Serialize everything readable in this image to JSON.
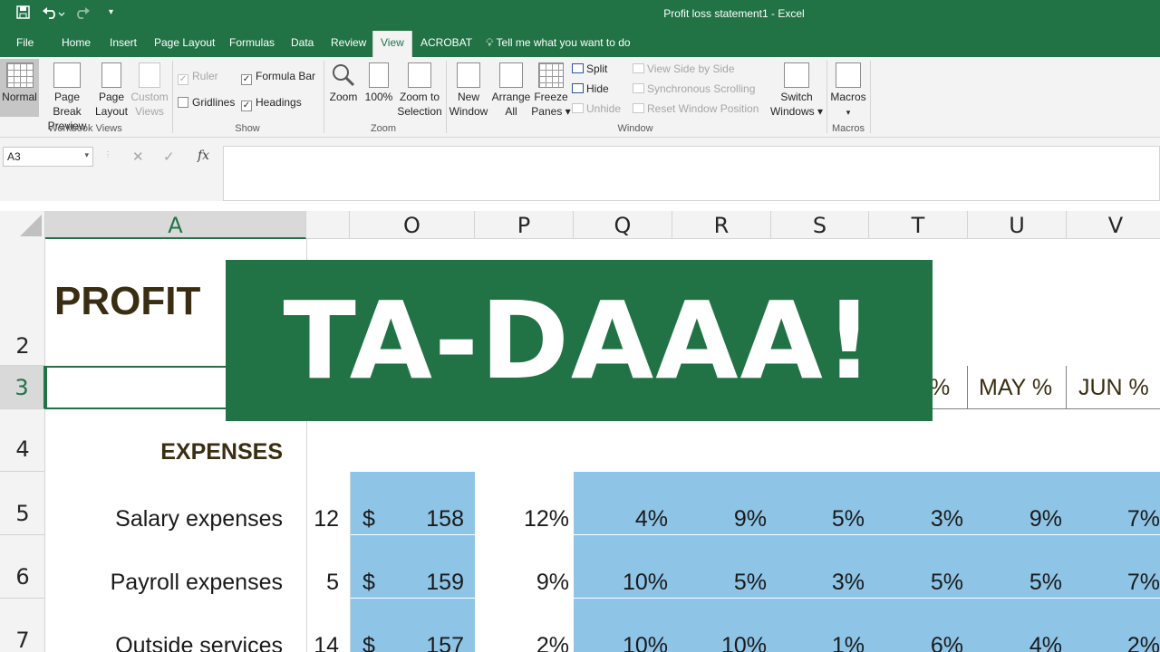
{
  "titlebar": {
    "title": "Profit loss statement1  -  Excel",
    "save_icon": "save-icon",
    "undo_icon": "undo-icon",
    "redo_icon": "redo-icon"
  },
  "tabs": {
    "file": "File",
    "home": "Home",
    "insert": "Insert",
    "page_layout": "Page Layout",
    "formulas": "Formulas",
    "data": "Data",
    "review": "Review",
    "view": "View",
    "acrobat": "ACROBAT",
    "tell_me": "Tell me what you want to do"
  },
  "ribbon": {
    "workbook_views": {
      "label": "Workbook Views",
      "normal": "Normal",
      "page_break_1": "Page Break",
      "page_break_2": "Preview",
      "page_layout_1": "Page",
      "page_layout_2": "Layout",
      "custom_1": "Custom",
      "custom_2": "Views"
    },
    "show": {
      "label": "Show",
      "ruler": "Ruler",
      "formula_bar": "Formula Bar",
      "gridlines": "Gridlines",
      "headings": "Headings",
      "check": "✓"
    },
    "zoom": {
      "label": "Zoom",
      "zoom": "Zoom",
      "hundred": "100%",
      "zoom_sel_1": "Zoom to",
      "zoom_sel_2": "Selection"
    },
    "window": {
      "label": "Window",
      "new_1": "New",
      "new_2": "Window",
      "arrange_1": "Arrange",
      "arrange_2": "All",
      "freeze_1": "Freeze",
      "freeze_2": "Panes ▾",
      "split": "Split",
      "hide": "Hide",
      "unhide": "Unhide",
      "side_by_side": "View Side by Side",
      "sync_scroll": "Synchronous Scrolling",
      "reset_pos": "Reset Window Position",
      "switch_1": "Switch",
      "switch_2": "Windows ▾"
    },
    "macros": {
      "label": "Macros",
      "macros_1": "Macros",
      "macros_2": "▾"
    }
  },
  "formula_bar": {
    "name_box": "A3",
    "cancel": "✕",
    "enter": "✓",
    "fx": "fx",
    "value": ""
  },
  "grid": {
    "columns": [
      "A",
      "O",
      "P",
      "Q",
      "R",
      "S",
      "T",
      "U",
      "V"
    ],
    "rows": [
      "2",
      "3",
      "4",
      "5",
      "6",
      "7"
    ],
    "title_partial": "PROFIT",
    "header_partial": "%",
    "may": "MAY %",
    "jun": "JUN %",
    "expenses": "EXPENSES",
    "data_rows": [
      {
        "label": "Salary expenses",
        "n": "12",
        "cur": "$",
        "amt": "158",
        "p": "12%",
        "q": "4%",
        "r": "9%",
        "s": "5%",
        "t": "3%",
        "u": "9%",
        "v": "7%"
      },
      {
        "label": "Payroll expenses",
        "n": "5",
        "cur": "$",
        "amt": "159",
        "p": "9%",
        "q": "10%",
        "r": "5%",
        "s": "3%",
        "t": "5%",
        "u": "5%",
        "v": "7%"
      },
      {
        "label": "Outside services",
        "n": "14",
        "cur": "$",
        "amt": "157",
        "p": "2%",
        "q": "10%",
        "r": "10%",
        "s": "1%",
        "t": "6%",
        "u": "4%",
        "v": "2%"
      }
    ]
  },
  "overlay": {
    "text": "TA-DAAA!"
  },
  "colors": {
    "excel_green": "#217346",
    "cell_blue": "#8ec4e6"
  }
}
